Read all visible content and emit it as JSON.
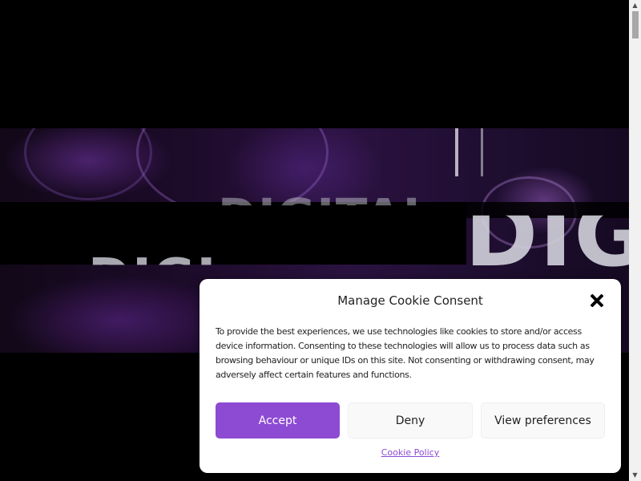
{
  "hero": {
    "word_top": "DIGITAL",
    "word_right": "DIGI",
    "word_left": "DIGI"
  },
  "cookie_dialog": {
    "title": "Manage Cookie Consent",
    "message": "To provide the best experiences, we use technologies like cookies to store and/or access device information. Consenting to these technologies will allow us to process data such as browsing behaviour or unique IDs on this site. Not consenting or withdrawing consent, may adversely affect certain features and functions.",
    "accept_label": "Accept",
    "deny_label": "Deny",
    "preferences_label": "View preferences",
    "policy_link": "Cookie Policy",
    "close_icon": "close-icon"
  },
  "colors": {
    "accent": "#8d4bd3",
    "dialog_bg": "#ffffff",
    "page_bg": "#000000"
  }
}
